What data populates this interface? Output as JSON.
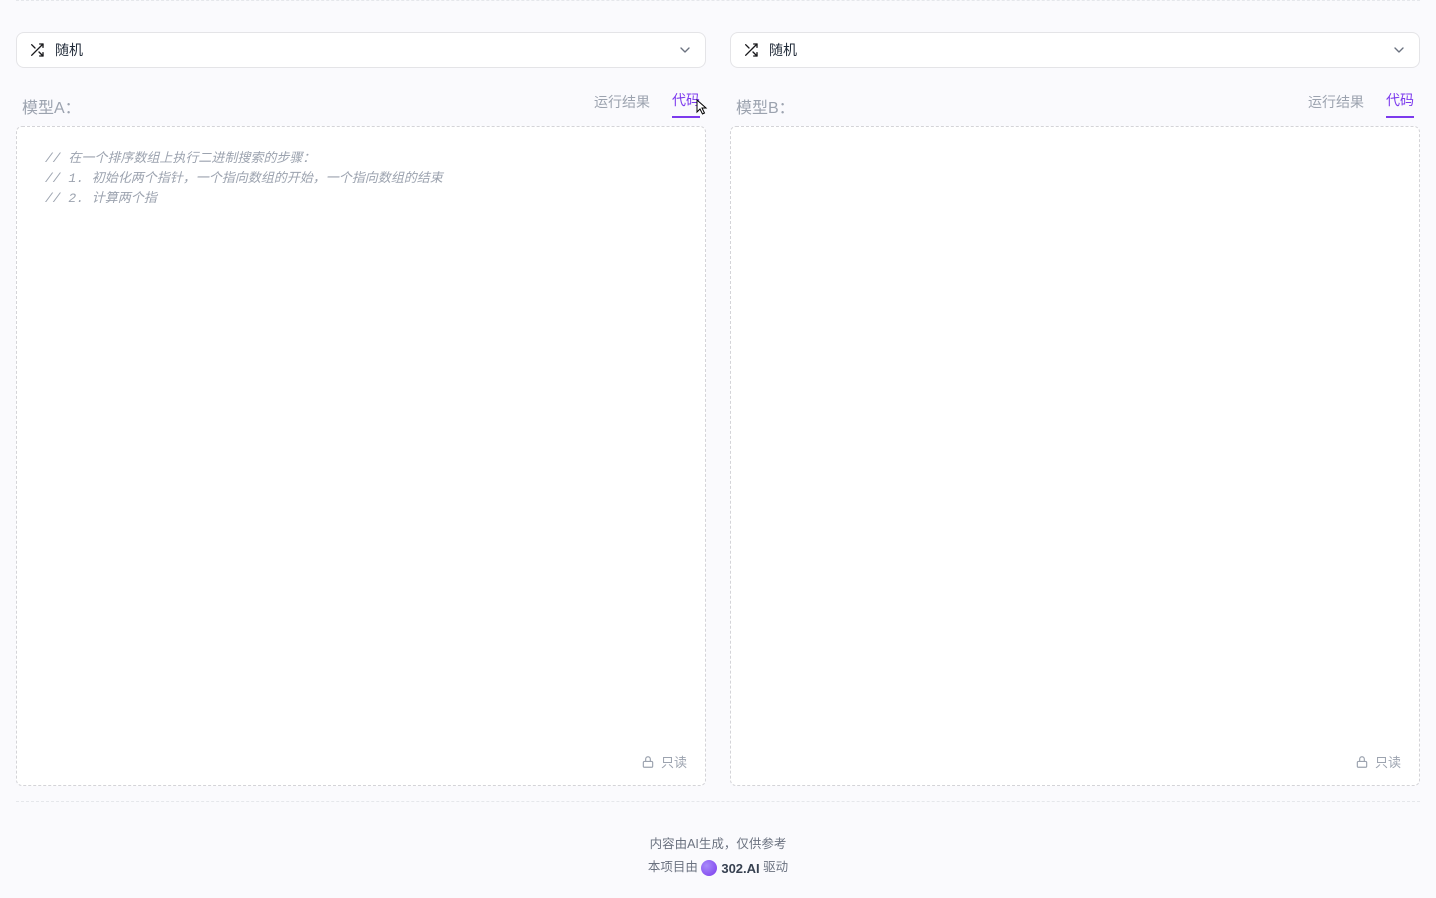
{
  "select": {
    "label": "随机"
  },
  "panelA": {
    "modelLabel": "模型A：",
    "tabs": {
      "results": "运行结果",
      "code": "代码"
    },
    "code": "// 在一个排序数组上执行二进制搜索的步骤：\n// 1. 初始化两个指针，一个指向数组的开始，一个指向数组的结束\n// 2. 计算两个指",
    "readonly": "只读"
  },
  "panelB": {
    "modelLabel": "模型B：",
    "tabs": {
      "results": "运行结果",
      "code": "代码"
    },
    "code": "",
    "readonly": "只读"
  },
  "footer": {
    "disclaimer": "内容由AI生成，仅供参考",
    "prefix": "本项目由",
    "brand": "302.AI",
    "suffix": "驱动"
  }
}
